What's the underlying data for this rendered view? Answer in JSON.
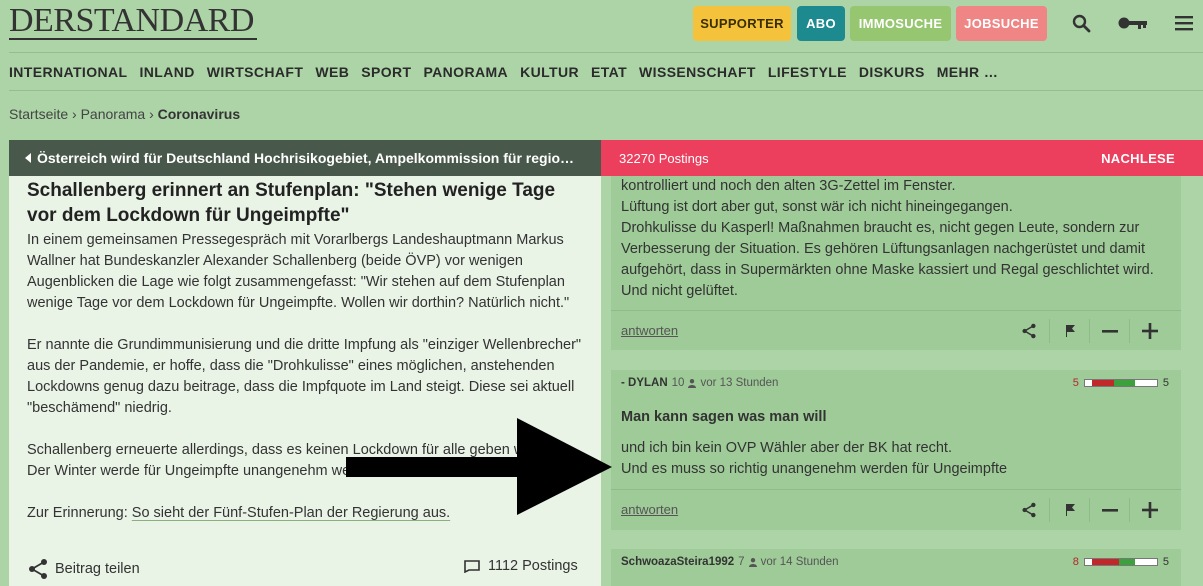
{
  "header": {
    "logo": "DERSTANDARD",
    "buttons": {
      "supporter": "SUPPORTER",
      "abo": "ABO",
      "immosuche": "IMMOSUCHE",
      "jobsuche": "JOBSUCHE"
    },
    "icons": [
      "search-icon",
      "key-icon",
      "menu-icon"
    ],
    "colors": {
      "supporter": "#f4c33b",
      "abo": "#1d8a8f",
      "immosuche": "#96c66f",
      "jobsuche": "#ef8585"
    }
  },
  "nav": [
    "INTERNATIONAL",
    "INLAND",
    "WIRTSCHAFT",
    "WEB",
    "SPORT",
    "PANORAMA",
    "KULTUR",
    "ETAT",
    "WISSENSCHAFT",
    "LIFESTYLE",
    "DISKURS",
    "MEHR …"
  ],
  "breadcrumb": {
    "home": "Startseite",
    "section": "Panorama",
    "current": "Coronavirus",
    "sep": "›"
  },
  "article": {
    "prev_label": "Österreich wird für Deutschland Hochrisikogebiet, Ampelkommission für regio…",
    "title": "Schallenberg erinnert an Stufenplan: \"Stehen wenige Tage vor dem Lockdown für Ungeimpfte\"",
    "p1": "In einem gemeinsamen Pressegespräch mit Vorarlbergs Landeshauptmann Markus Wallner hat Bundeskanzler Alexander Schallenberg (beide ÖVP) vor wenigen Augenblicken die Lage wie folgt zusammengefasst: \"Wir stehen auf dem Stufenplan wenige Tage vor dem Lockdown für Ungeimpfte. Wollen wir dorthin? Natürlich nicht.\"",
    "p2": "Er nannte die Grundimmunisierung und die dritte Impfung als \"einziger Wellenbrecher\" aus der Pandemie, er hoffe, dass die \"Drohkulisse\" eines möglichen, anstehenden Lockdowns genug dazu beitrage, dass die Impfquote im Land steigt. Diese sei aktuell \"beschämend\" niedrig.",
    "p3": "Schallenberg erneuerte allerdings, dass es keinen Lockdown für alle geben werde. Der Winter werde für Ungeimpfte unangenehm werden.",
    "p4_prefix": "Zur Erinnerung: ",
    "p4_link": "So sieht der Fünf-Stufen-Plan der Regierung aus.",
    "share_label": "Beitrag teilen",
    "postings_count": "1112 Postings"
  },
  "forum": {
    "postings_total": "32270 Postings",
    "nachlese": "NACHLESE",
    "reply_label": "antworten",
    "posts": [
      {
        "lines": [
          "kontrolliert und noch den alten 3G-Zettel im Fenster.",
          "Lüftung ist dort aber gut, sonst wär ich nicht hineingegangen.",
          "Drohkulisse du Kasperl! Maßnahmen braucht es, nicht gegen Leute, sondern zur",
          "Verbesserung der Situation. Es gehören Lüftungsanlagen nachgerüstet und damit",
          "aufgehört, dass in Supermärkten ohne Maske kassiert und Regal geschlichtet wird.",
          "Und nicht gelüftet."
        ]
      },
      {
        "author": "- DYLAN",
        "followers": "10",
        "time": "vor 13 Stunden",
        "neg": "5",
        "pos": "5",
        "neg_share": 0.5,
        "title": "Man kann sagen was man will",
        "lines": [
          "und ich bin kein OVP Wähler aber der BK hat recht.",
          "Und es muss so richtig unangenehm werden für Ungeimpfte"
        ]
      },
      {
        "author": "SchwoazaSteira1992",
        "followers": "7",
        "time": "vor 14 Stunden",
        "neg": "8",
        "pos": "5",
        "neg_share": 0.62
      }
    ]
  }
}
